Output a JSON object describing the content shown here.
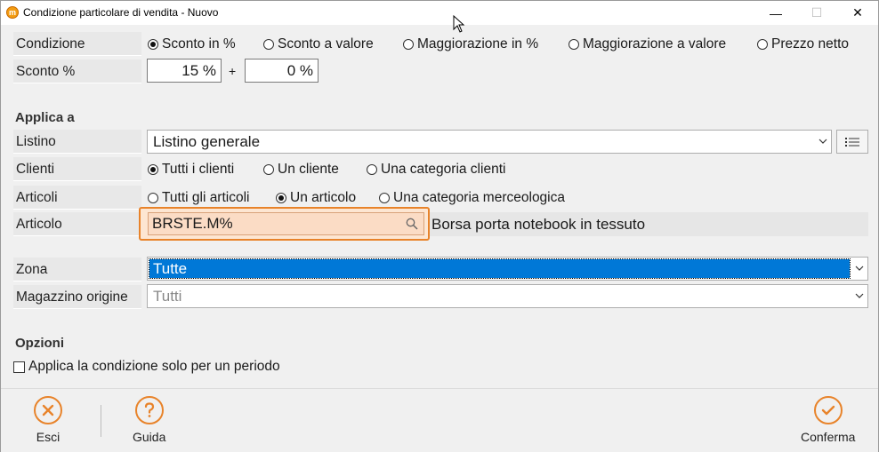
{
  "window": {
    "title": "Condizione particolare di vendita - Nuovo",
    "app_icon_letter": "m",
    "minimize": "—",
    "maximize": "☐",
    "close": "✕"
  },
  "condizione": {
    "label": "Condizione",
    "options": [
      {
        "label": "Sconto in %",
        "selected": true
      },
      {
        "label": "Sconto a valore",
        "selected": false
      },
      {
        "label": "Maggiorazione in %",
        "selected": false
      },
      {
        "label": "Maggiorazione a valore",
        "selected": false
      },
      {
        "label": "Prezzo netto",
        "selected": false
      }
    ]
  },
  "sconto": {
    "label": "Sconto %",
    "value1": "15 %",
    "plus": "+",
    "value2": "0 %"
  },
  "applica": {
    "title": "Applica a",
    "listino_label": "Listino",
    "listino_value": "Listino generale",
    "clienti_label": "Clienti",
    "clienti_options": [
      {
        "label": "Tutti i clienti",
        "selected": true
      },
      {
        "label": "Un cliente",
        "selected": false
      },
      {
        "label": "Una categoria clienti",
        "selected": false
      }
    ],
    "articoli_label": "Articoli",
    "articoli_options": [
      {
        "label": "Tutti gli articoli",
        "selected": false
      },
      {
        "label": "Un articolo",
        "selected": true
      },
      {
        "label": "Una categoria merceologica",
        "selected": false
      }
    ],
    "articolo_label": "Articolo",
    "articolo_code": "BRSTE.M%",
    "articolo_desc": "Borsa porta notebook in tessuto"
  },
  "zona": {
    "label": "Zona",
    "value": "Tutte"
  },
  "magazzino": {
    "label": "Magazzino origine",
    "value": "Tutti"
  },
  "opzioni": {
    "title": "Opzioni",
    "periodo_label": "Applica la condizione solo per un periodo"
  },
  "footer": {
    "esci": "Esci",
    "guida": "Guida",
    "conferma": "Conferma"
  },
  "colors": {
    "accent": "#e8832a",
    "selection": "#0078d7"
  },
  "icons": [
    "close-circle-icon",
    "help-circle-icon",
    "check-circle-icon",
    "search-icon",
    "list-icon",
    "chevron-down-icon"
  ]
}
